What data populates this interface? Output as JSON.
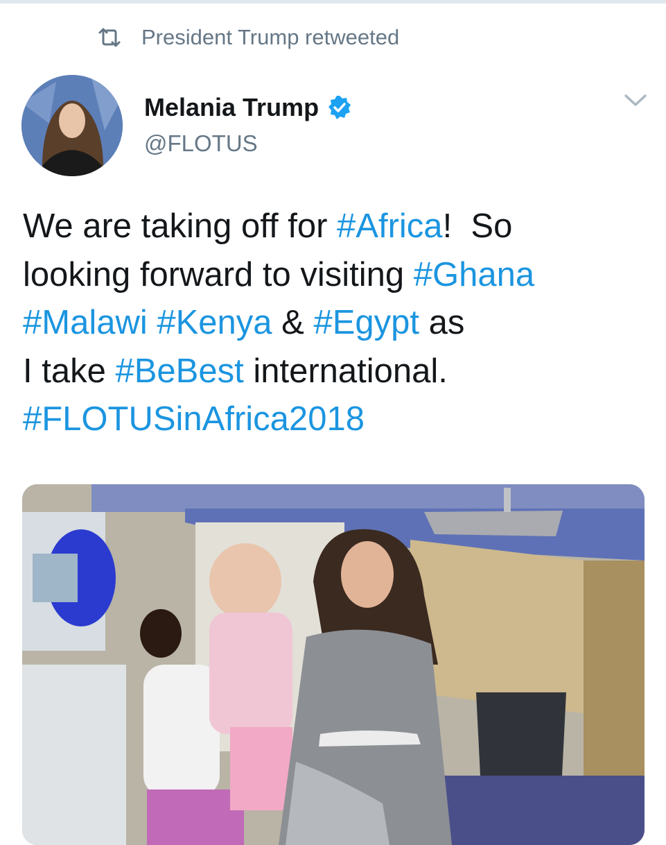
{
  "retweet": {
    "icon": "retweet-icon",
    "text": "President Trump retweeted"
  },
  "author": {
    "name": "Melania Trump",
    "handle": "@FLOTUS",
    "verified": true,
    "verified_color": "#1da1f2"
  },
  "tweet": {
    "line1_a": "We are taking off for ",
    "line1_tag": "#Africa",
    "line1_b": "!  So",
    "line2_a": "looking forward to visiting ",
    "line2_tag": "#Ghana",
    "line3_tag1": "#Malawi",
    "line3_sp1": " ",
    "line3_tag2": "#Kenya",
    "line3_amp": " & ",
    "line3_tag3": "#Egypt",
    "line3_b": " as",
    "line4_a": "I take ",
    "line4_tag": "#BeBest",
    "line4_b": " international.",
    "line5_tag": "#FLOTUSinAfrica2018",
    "hashtag_color": "#1b95e0"
  },
  "media": {
    "type": "photo"
  }
}
